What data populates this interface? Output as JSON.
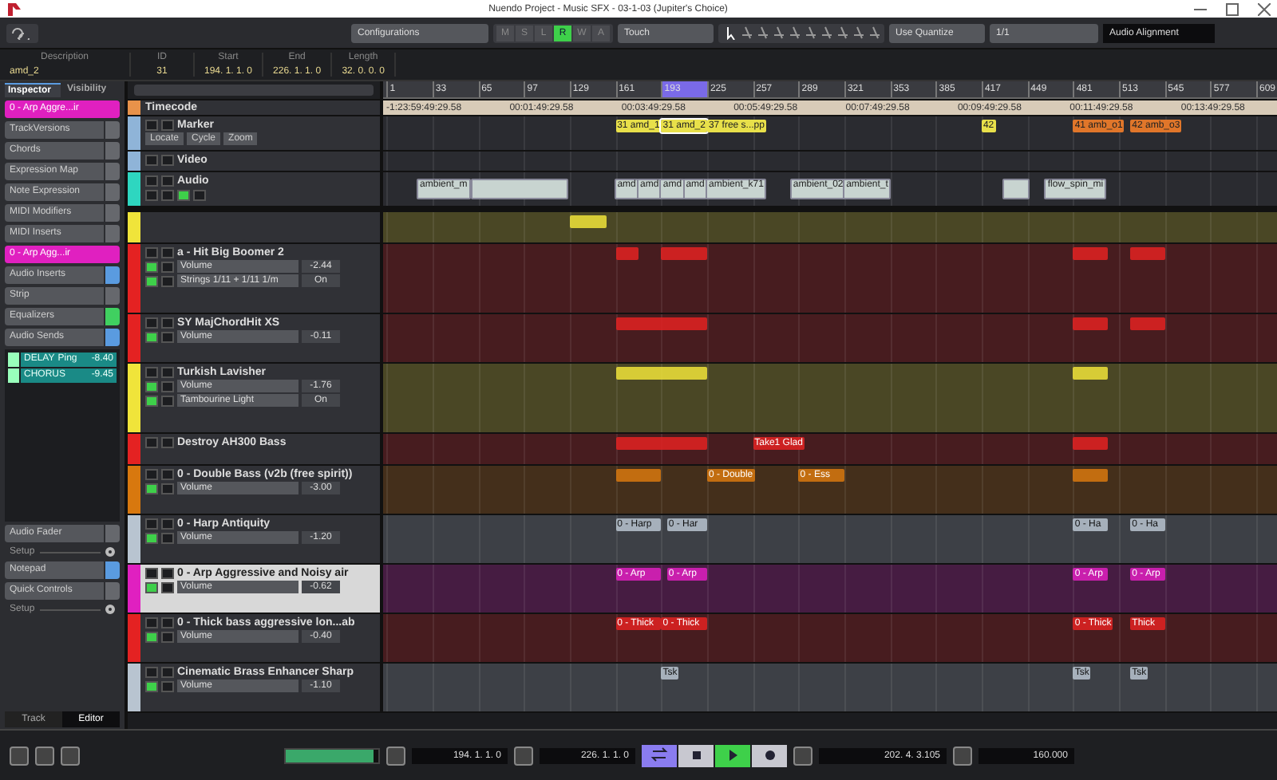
{
  "window": {
    "title": "Nuendo Project - Music SFX - 03-1-03 (Jupiter's Choice)"
  },
  "toolbar": {
    "configurations": "Configurations",
    "automation_modes": [
      {
        "label": "M",
        "selected": false
      },
      {
        "label": "S",
        "selected": false
      },
      {
        "label": "L",
        "selected": false
      },
      {
        "label": "R",
        "selected": true
      },
      {
        "label": "W",
        "selected": false
      },
      {
        "label": "A",
        "selected": false
      }
    ],
    "touch_mode": "Touch",
    "quantize_mode": "Use Quantize",
    "quantize_value": "1/1",
    "alignment": "Audio Alignment"
  },
  "info_line": [
    {
      "label": "Description",
      "value": "amd_2"
    },
    {
      "label": "ID",
      "value": "31"
    },
    {
      "label": "Start",
      "value": "194. 1. 1.   0"
    },
    {
      "label": "End",
      "value": "226. 1. 1.   0"
    },
    {
      "label": "Length",
      "value": "32. 0. 0.   0"
    }
  ],
  "inspector": {
    "tabs": [
      {
        "label": "Inspector",
        "selected": true
      },
      {
        "label": "Visibility",
        "selected": false
      }
    ],
    "sections": [
      {
        "kind": "header",
        "label": "0 - Arp Aggre...ir"
      },
      {
        "kind": "section",
        "label": "TrackVersions"
      },
      {
        "kind": "section",
        "label": "Chords"
      },
      {
        "kind": "section",
        "label": "Expression Map"
      },
      {
        "kind": "section",
        "label": "Note Expression"
      },
      {
        "kind": "section",
        "label": "MIDI Modifiers"
      },
      {
        "kind": "section",
        "label": "MIDI Inserts"
      },
      {
        "kind": "header",
        "label": "0 - Arp Agg...ir"
      },
      {
        "kind": "section",
        "label": "Audio Inserts",
        "color": "#5a9be0"
      },
      {
        "kind": "section",
        "label": "Strip"
      },
      {
        "kind": "section",
        "label": "Equalizers",
        "color": "#40d060"
      },
      {
        "kind": "section",
        "label": "Audio Sends",
        "color": "#5a9be0"
      }
    ],
    "sends": [
      {
        "name": "DELAY",
        "detail": "Ping",
        "value": "-8.40"
      },
      {
        "name": "CHORUS",
        "value": "-9.45"
      }
    ],
    "lower_sections": [
      {
        "kind": "section",
        "label": "Audio Fader"
      },
      {
        "kind": "setup",
        "label": "Setup"
      },
      {
        "kind": "section",
        "label": "Notepad",
        "color": "#5a9be0"
      },
      {
        "kind": "section",
        "label": "Quick Controls"
      },
      {
        "kind": "setup",
        "label": "Setup"
      }
    ],
    "bottom_tabs": [
      {
        "label": "Track",
        "selected": false
      },
      {
        "label": "Editor",
        "selected": true
      }
    ]
  },
  "ruler": {
    "bars": [
      "1",
      "33",
      "65",
      "97",
      "129",
      "161",
      "193",
      "225",
      "257",
      "289",
      "321",
      "353",
      "385",
      "417",
      "449",
      "481",
      "513",
      "545",
      "577",
      "609"
    ]
  },
  "global_tracks": [
    {
      "kind": "timecode",
      "name": "Timecode",
      "color": "#e8924a",
      "timecodes": [
        "-1:23:59:49:29.58",
        "00:01:49:29.58",
        "00:03:49:29.58",
        "00:05:49:29.58",
        "00:07:49:29.58",
        "00:09:49:29.58",
        "00:11:49:29.58",
        "00:13:49:29.58"
      ]
    },
    {
      "kind": "marker",
      "name": "Marker",
      "color": "#8fb4d8",
      "buttons": [
        "Locate",
        "Cycle",
        "Zoom"
      ],
      "events": [
        {
          "label": "31 amd_1",
          "color": "#e8e04a",
          "selected": false
        },
        {
          "label": "31 amd_2",
          "color": "#e8e04a",
          "selected": true
        },
        {
          "label": "37 free s...pp",
          "color": "#e8e04a",
          "selected": false
        },
        {
          "label": "42",
          "color": "#e8e04a",
          "selected": false
        },
        {
          "label": "41 amb_o1",
          "color": "#e0762a",
          "selected": false
        },
        {
          "label": "42 amb_o3",
          "color": "#e0762a",
          "selected": false
        }
      ]
    },
    {
      "kind": "video",
      "name": "Video",
      "color": "#8fb4d8"
    },
    {
      "kind": "audio",
      "name": "Audio",
      "color": "#2ed6c0",
      "events": [
        {
          "label": "ambient_m"
        },
        {
          "selected": false
        },
        {
          "label": "amd"
        },
        {
          "label": "amd"
        },
        {
          "label": "amd"
        },
        {
          "label": "amd"
        },
        {
          "label": "ambient_k71"
        },
        {
          "label": "ambient_02"
        },
        {
          "label": "ambient_t"
        },
        {
          "selected": false
        },
        {
          "label": "flow_spin_mi"
        }
      ]
    }
  ],
  "tracks": [
    {
      "color": "#f0e43a",
      "selected": false,
      "events": [
        {
          "selected": false
        }
      ]
    },
    {
      "name": "a - Hit Big Boomer 2",
      "color": "#e42222",
      "selected": false,
      "params": [
        {
          "label": "Volume",
          "value": "-2.44"
        },
        {
          "label": "Strings 1/11 + 1/11 1/m",
          "value": "On"
        }
      ],
      "events": [
        {
          "selected": false
        },
        {
          "selected": false
        },
        {
          "selected": false
        },
        {
          "selected": false
        }
      ]
    },
    {
      "name": "SY MajChordHit XS",
      "color": "#e42222",
      "selected": false,
      "params": [
        {
          "label": "Volume",
          "value": "-0.11"
        }
      ],
      "events": [
        {
          "selected": false
        },
        {
          "selected": false
        },
        {
          "selected": false
        }
      ]
    },
    {
      "name": "Turkish Lavisher",
      "color": "#f0e43a",
      "selected": false,
      "params": [
        {
          "label": "Volume",
          "value": "-1.76"
        },
        {
          "label": "Tambourine Light",
          "value": "On"
        }
      ],
      "events": [
        {
          "selected": false
        },
        {
          "selected": false
        }
      ]
    },
    {
      "name": "Destroy AH300 Bass",
      "color": "#e42222",
      "selected": false,
      "events": [
        {
          "selected": false
        },
        {
          "label": "Take1 Glad"
        },
        {
          "selected": false
        }
      ]
    },
    {
      "name": "0 -  Double Bass  (v2b (free spirit))",
      "color": "#d8780e",
      "selected": false,
      "params": [
        {
          "label": "Volume",
          "value": "-3.00"
        }
      ],
      "events": [
        {
          "selected": false
        },
        {
          "label": "0 - Double"
        },
        {
          "label": "0 - Ess"
        },
        {
          "selected": false
        }
      ]
    },
    {
      "name": "0 - Harp Antiquity",
      "color": "#b8c4d0",
      "selected": false,
      "params": [
        {
          "label": "Volume",
          "value": "-1.20"
        }
      ],
      "events": [
        {
          "label": "0 - Harp"
        },
        {
          "label": "0 - Har"
        },
        {
          "label": "0 - Ha"
        },
        {
          "label": "0 - Ha"
        }
      ]
    },
    {
      "name": "0 - Arp Aggressive and Noisy air",
      "color": "#e020c0",
      "selected": true,
      "params": [
        {
          "label": "Volume",
          "value": "-0.62"
        }
      ],
      "events": [
        {
          "label": "0 - Arp"
        },
        {
          "label": "0 - Arp"
        },
        {
          "label": "0 - Arp"
        },
        {
          "label": "0 - Arp"
        }
      ]
    },
    {
      "name": "0 - Thick bass aggressive lon...ab",
      "color": "#e42222",
      "selected": false,
      "params": [
        {
          "label": "Volume",
          "value": "-0.40"
        }
      ],
      "events": [
        {
          "label": "0 - Thick"
        },
        {
          "label": "0 - Thick"
        },
        {
          "label": "0 - Thick"
        },
        {
          "label": "Thick"
        }
      ]
    },
    {
      "name": "Cinematic Brass Enhancer Sharp",
      "color": "#b8c4d0",
      "selected": false,
      "params": [
        {
          "label": "Volume",
          "value": "-1.10"
        }
      ],
      "events": [
        {
          "label": "Tsk"
        },
        {
          "label": "Tsk"
        },
        {
          "label": "Tsk"
        }
      ]
    }
  ],
  "transport": {
    "meter": {
      "level": 0.95
    },
    "left_locator": "194. 1. 1.   0",
    "right_locator": "226. 1. 1.   0",
    "buttons": [
      {
        "kind": "cycle",
        "on": true
      },
      {
        "kind": "stop",
        "on": false
      },
      {
        "kind": "play",
        "on": true
      },
      {
        "kind": "record",
        "on": false
      }
    ],
    "position": "202. 4. 3.105",
    "tempo": "160.000"
  }
}
